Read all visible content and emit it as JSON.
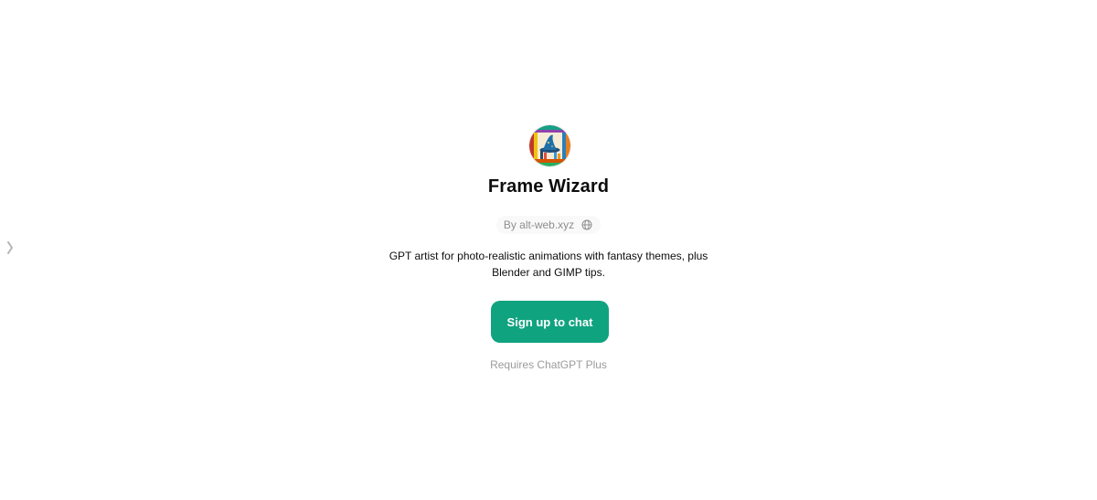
{
  "gpt": {
    "name": "Frame Wizard",
    "author": "By alt-web.xyz",
    "description_line1": "GPT artist for photo-realistic animations with fantasy themes, plus",
    "description_line2": "Blender and GIMP tips.",
    "avatar_icon": "wizard-hat-avatar",
    "author_link_icon": "globe-icon"
  },
  "cta": {
    "label": "Sign up to chat",
    "color": "#10a37f"
  },
  "requirement": "Requires ChatGPT Plus",
  "sidebar": {
    "toggle_icon": "chevron-right-icon"
  }
}
